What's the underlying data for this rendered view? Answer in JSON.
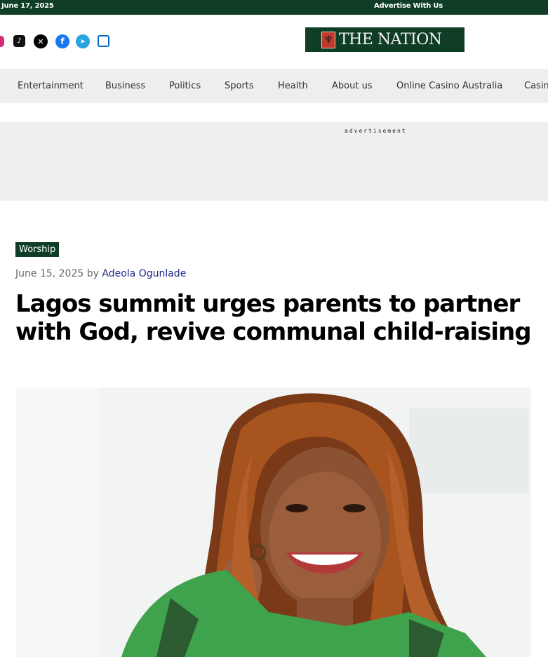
{
  "topbar": {
    "date": "June 17, 2025",
    "advertise": "Advertise With Us"
  },
  "social": [
    "instagram-icon",
    "tiktok-icon",
    "x-icon",
    "facebook-icon",
    "telegram-icon",
    "linkedin-icon"
  ],
  "logo": {
    "text": "THE NATION"
  },
  "nav": [
    "Entertainment",
    "Business",
    "Politics",
    "Sports",
    "Health",
    "About us",
    "Online Casino Australia",
    "Casin"
  ],
  "ad": {
    "label": "advertisement"
  },
  "article": {
    "category": "Worship",
    "date": "June 15, 2025",
    "by": "by",
    "author": "Adeola Ogunlade",
    "headline": "Lagos summit urges parents to partner with God, revive communal child-raising"
  },
  "colors": {
    "brand": "#0f3d25",
    "author_link": "#1f2a8a",
    "nav_bg": "#eeeeee"
  }
}
